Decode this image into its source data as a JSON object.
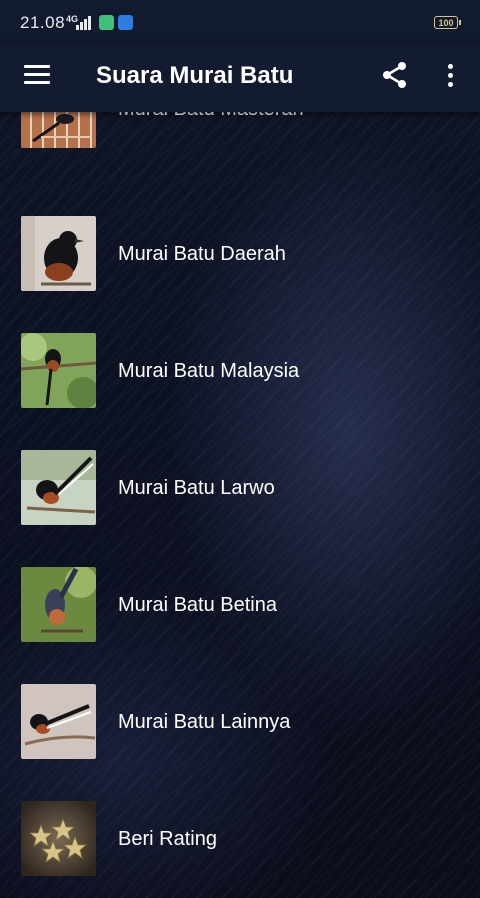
{
  "status_bar": {
    "time": "21.08",
    "network": "4G",
    "battery": "100"
  },
  "app_bar": {
    "title": "Suara Murai Batu",
    "menu_icon": "hamburger-menu-icon",
    "share_icon": "share-icon",
    "more_icon": "more-vert-icon"
  },
  "menu": {
    "items": [
      {
        "label": "Murai Batu Masteran"
      },
      {
        "label": "Murai Batu Daerah"
      },
      {
        "label": "Murai Batu Malaysia"
      },
      {
        "label": "Murai Batu Larwo"
      },
      {
        "label": "Murai Batu Betina"
      },
      {
        "label": "Murai Batu Lainnya"
      },
      {
        "label": "Beri Rating"
      }
    ]
  },
  "colors": {
    "app_bar": "#131b31",
    "status_bar": "#121a2e",
    "text": "#ffffff"
  }
}
